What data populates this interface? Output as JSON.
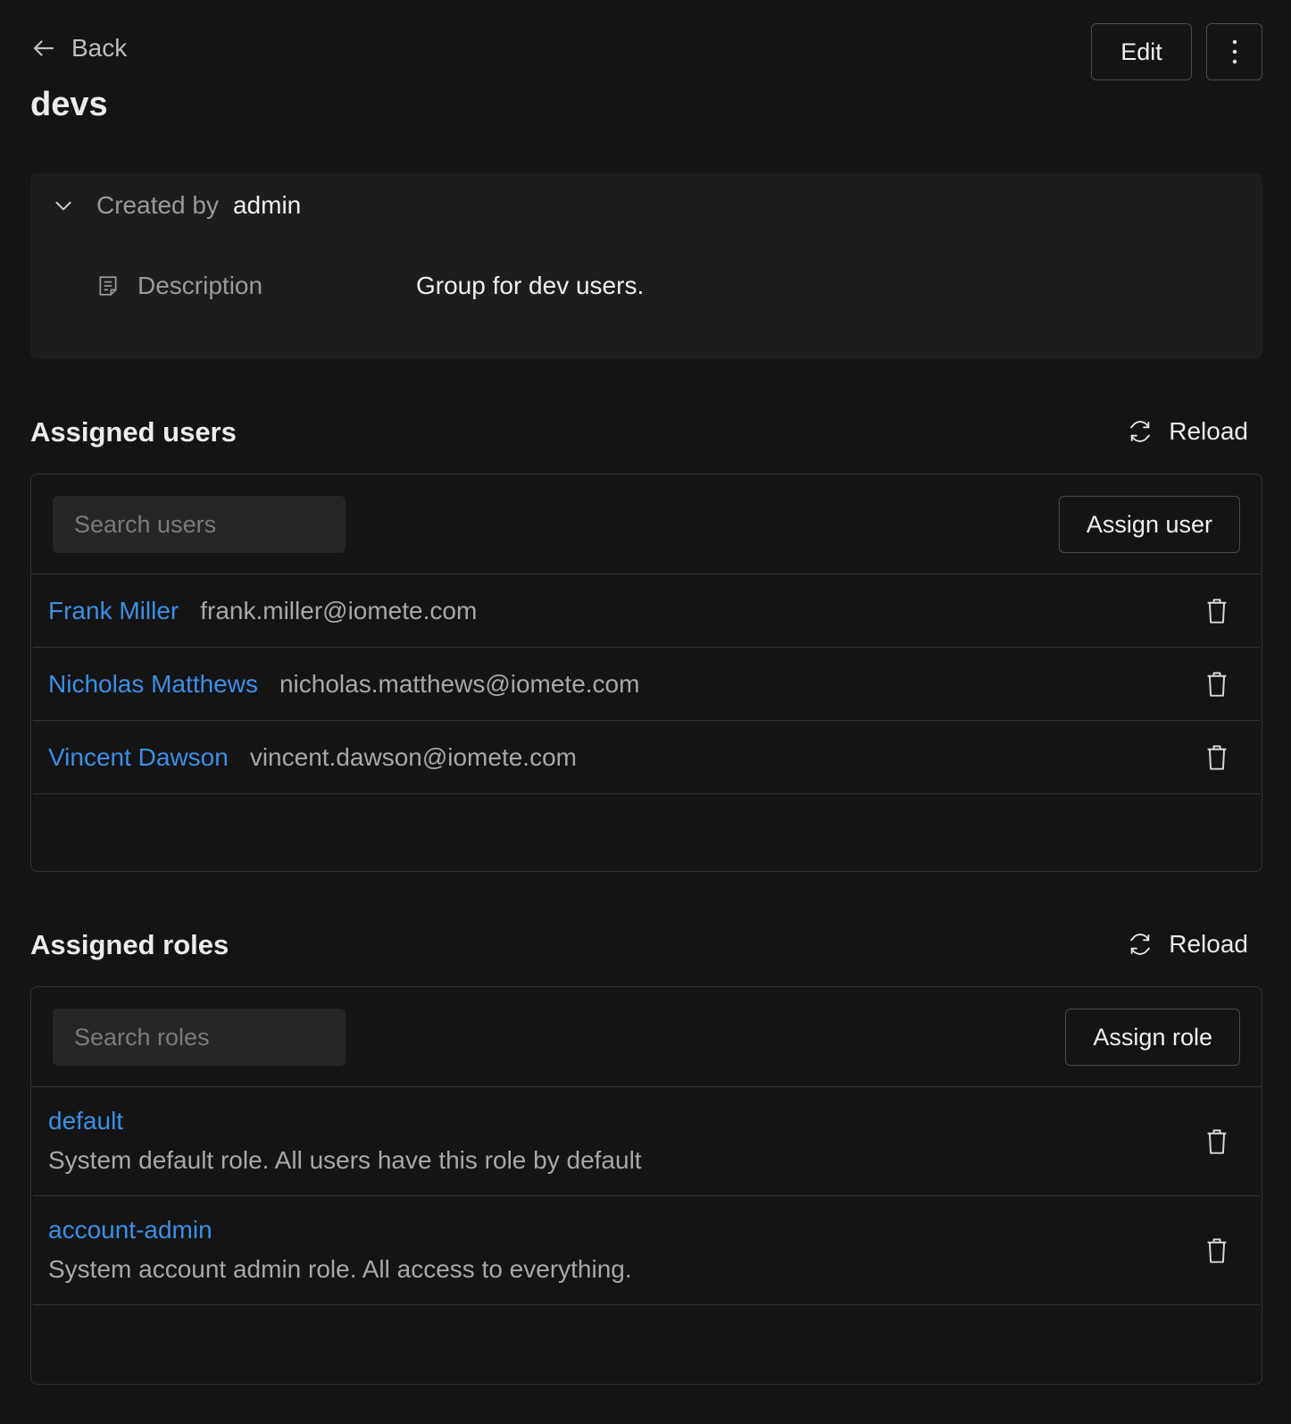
{
  "nav": {
    "back_label": "Back"
  },
  "actions": {
    "edit_label": "Edit"
  },
  "group": {
    "name": "devs",
    "created_by_label": "Created by",
    "created_by_value": "admin",
    "description_label": "Description",
    "description_value": "Group for dev users."
  },
  "users": {
    "title": "Assigned users",
    "reload_label": "Reload",
    "search_placeholder": "Search users",
    "assign_label": "Assign user",
    "items": [
      {
        "name": "Frank Miller",
        "email": "frank.miller@iomete.com"
      },
      {
        "name": "Nicholas Matthews",
        "email": "nicholas.matthews@iomete.com"
      },
      {
        "name": "Vincent Dawson",
        "email": "vincent.dawson@iomete.com"
      }
    ]
  },
  "roles": {
    "title": "Assigned roles",
    "reload_label": "Reload",
    "search_placeholder": "Search roles",
    "assign_label": "Assign role",
    "items": [
      {
        "name": "default",
        "description": "System default role. All users have this role by default"
      },
      {
        "name": "account-admin",
        "description": "System account admin role. All access to everything."
      }
    ]
  },
  "colors": {
    "link": "#3b8fe6",
    "background": "#141414",
    "card": "#1d1d1d"
  },
  "icons": [
    "arrow-left-icon",
    "more-vertical-icon",
    "chevron-down-icon",
    "document-icon",
    "refresh-icon",
    "trash-icon"
  ]
}
